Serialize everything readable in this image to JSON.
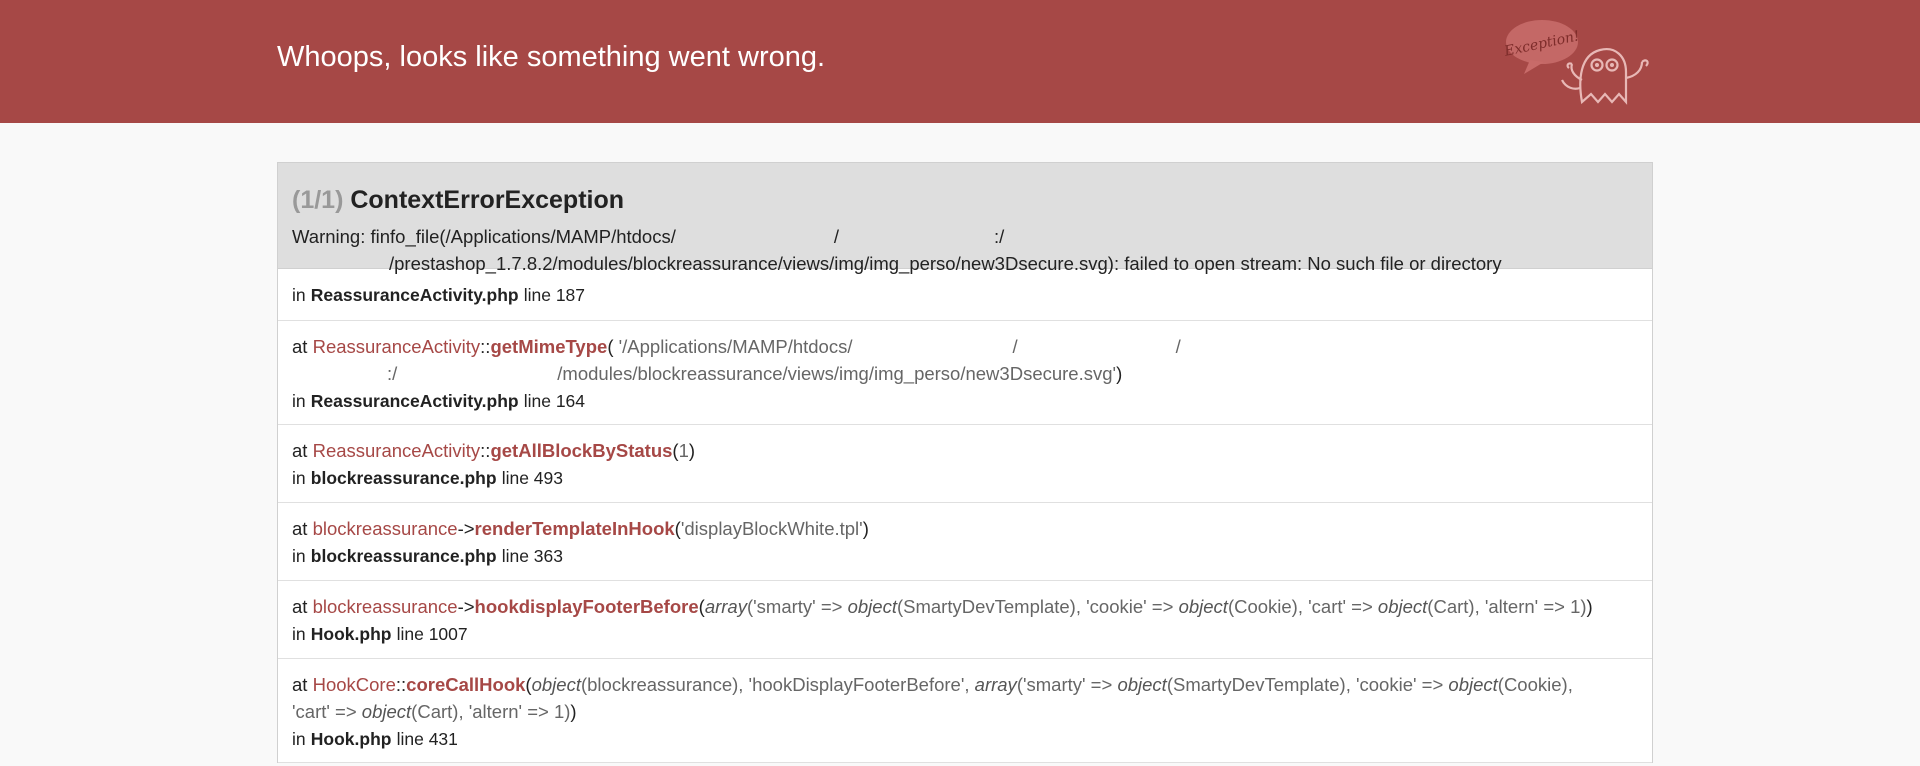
{
  "header": {
    "title": "Whoops, looks like something went wrong.",
    "mascot_text": "Exception!"
  },
  "exception": {
    "count": "(1/1)",
    "class": "ContextErrorException",
    "message_line1": "Warning: finfo_file(/Applications/MAMP/htdocs/",
    "message_sep1": "/",
    "message_sep2": ":/",
    "message_line2": "/prestashop_1.7.8.2/modules/blockreassurance/views/img/img_perso/new3Dsecure.svg): failed to open stream: No such file or directory"
  },
  "trace": {
    "first": {
      "in": "in",
      "file": "ReassuranceActivity.php",
      "line": "line 187"
    },
    "frames": [
      {
        "at": "at",
        "class": "ReassuranceActivity",
        "op": "::",
        "fn": "getMimeType",
        "args_line1": "'/Applications/MAMP/htdocs/",
        "args_sep1": "/",
        "args_sep2": "/",
        "args_sep3": ":/",
        "args_line2": "/modules/blockreassurance/views/img/img_perso/new3Dsecure.svg'",
        "in": "in",
        "file": "ReassuranceActivity.php",
        "line": "line 164"
      },
      {
        "at": "at",
        "class": "ReassuranceActivity",
        "op": "::",
        "fn": "getAllBlockByStatus",
        "args": "1",
        "in": "in",
        "file": "blockreassurance.php",
        "line": "line 493"
      },
      {
        "at": "at",
        "class": "blockreassurance",
        "op": "->",
        "fn": "renderTemplateInHook",
        "args": "'displayBlockWhite.tpl'",
        "in": "in",
        "file": "blockreassurance.php",
        "line": "line 363"
      },
      {
        "at": "at",
        "class": "blockreassurance",
        "op": "->",
        "fn": "hookdisplayFooterBefore",
        "args_parts": [
          "array",
          "('smarty' => ",
          "object",
          "(SmartyDevTemplate), 'cookie' => ",
          "object",
          "(Cookie), 'cart' => ",
          "object",
          "(Cart), 'altern' => 1)"
        ],
        "in": "in",
        "file": "Hook.php",
        "line": "line 1007"
      },
      {
        "at": "at",
        "class": "HookCore",
        "op": "::",
        "fn": "coreCallHook",
        "args_parts": [
          "object",
          "(blockreassurance), 'hookDisplayFooterBefore', ",
          "array",
          "('smarty' => ",
          "object",
          "(SmartyDevTemplate), 'cookie' => ",
          "object",
          "(Cookie),"
        ],
        "args_line2_parts": [
          "'cart' => ",
          "object",
          "(Cart), 'altern' => 1)"
        ],
        "in": "in",
        "file": "Hook.php",
        "line": "line 431"
      }
    ]
  },
  "colors": {
    "accent": "#a64846",
    "background": "#f9f9f9",
    "panel_head": "#dedede"
  },
  "icons": [
    "ghost-mascot-icon"
  ]
}
